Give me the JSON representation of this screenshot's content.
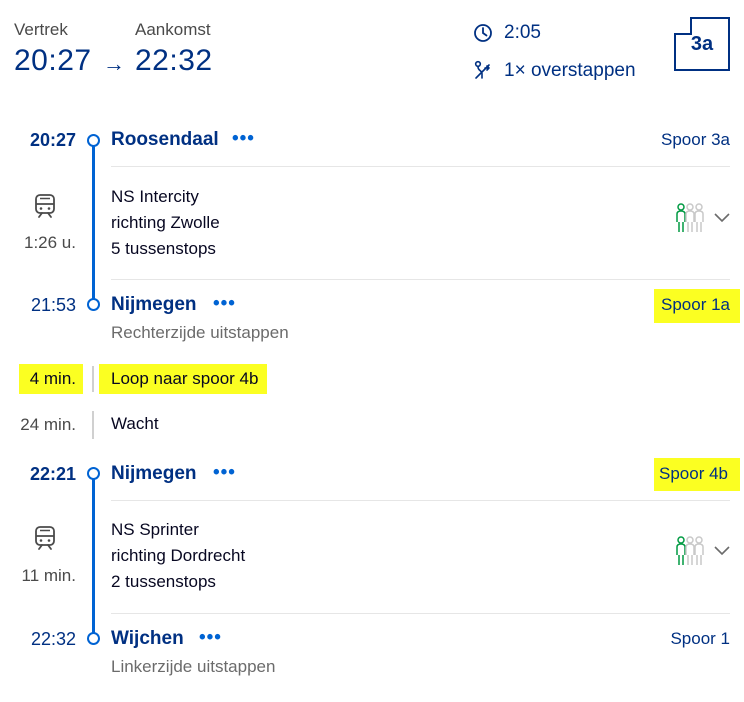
{
  "header": {
    "departure_label": "Vertrek",
    "arrival_label": "Aankomst",
    "departure_time": "20:27",
    "arrow": "→",
    "arrival_time": "22:32",
    "duration": "2:05",
    "transfers": "1× overstappen",
    "platform_badge": "3a",
    "icons": {
      "duration": "clock-icon",
      "transfers": "transfer-icon"
    }
  },
  "legs": [
    {
      "from": {
        "time": "20:27",
        "station": "Roosendaal",
        "more": "•••",
        "track": "Spoor 3a",
        "note": ""
      },
      "train": {
        "type": "NS Intercity",
        "direction": "richting Zwolle",
        "stops": "5 tussenstops",
        "duration": "1:26 u."
      },
      "to": {
        "time": "21:53",
        "station": "Nijmegen",
        "more": "•••",
        "track": "Spoor 1a",
        "note": "Rechterzijde uitstappen"
      }
    },
    {
      "from": {
        "time": "22:21",
        "station": "Nijmegen",
        "more": "•••",
        "track": "Spoor 4b",
        "note": ""
      },
      "train": {
        "type": "NS Sprinter",
        "direction": "richting Dordrecht",
        "stops": "2 tussenstops",
        "duration": "11 min."
      },
      "to": {
        "time": "22:32",
        "station": "Wijchen",
        "more": "•••",
        "track": "Spoor 1",
        "note": "Linkerzijde uitstappen"
      }
    }
  ],
  "transfer": {
    "walk": {
      "duration": "4 min.",
      "text": "Loop naar spoor 4b"
    },
    "wait": {
      "duration": "24 min.",
      "text": "Wacht"
    }
  },
  "colors": {
    "navy": "#003082",
    "blue": "#0063d3",
    "highlight": "#fbff22",
    "crowd_green": "#009a42"
  }
}
